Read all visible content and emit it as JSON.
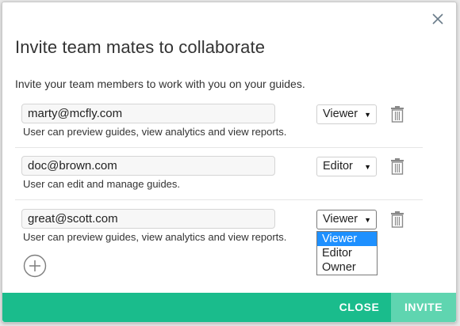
{
  "dialog": {
    "title": "Invite team mates to collaborate",
    "intro": "Invite your team members to work with you on your guides."
  },
  "invites": [
    {
      "email": "marty@mcfly.com",
      "role": "Viewer",
      "description": "User can preview guides, view analytics and view reports."
    },
    {
      "email": "doc@brown.com",
      "role": "Editor",
      "description": "User can edit and manage guides."
    },
    {
      "email": "great@scott.com",
      "role": "Viewer",
      "description": "User can preview guides, view analytics and view reports."
    }
  ],
  "role_dropdown": {
    "open_for_row": 3,
    "options": [
      "Viewer",
      "Editor",
      "Owner"
    ],
    "highlighted": "Viewer"
  },
  "footer": {
    "close_label": "CLOSE",
    "invite_label": "INVITE"
  },
  "colors": {
    "footer": "#1abc8c",
    "invite_button": "#5fd5b0",
    "option_highlight": "#1e90ff"
  },
  "icons": {
    "close": "close-icon",
    "delete": "trash-icon",
    "add": "plus-circle-icon",
    "caret": "caret-down-icon"
  }
}
